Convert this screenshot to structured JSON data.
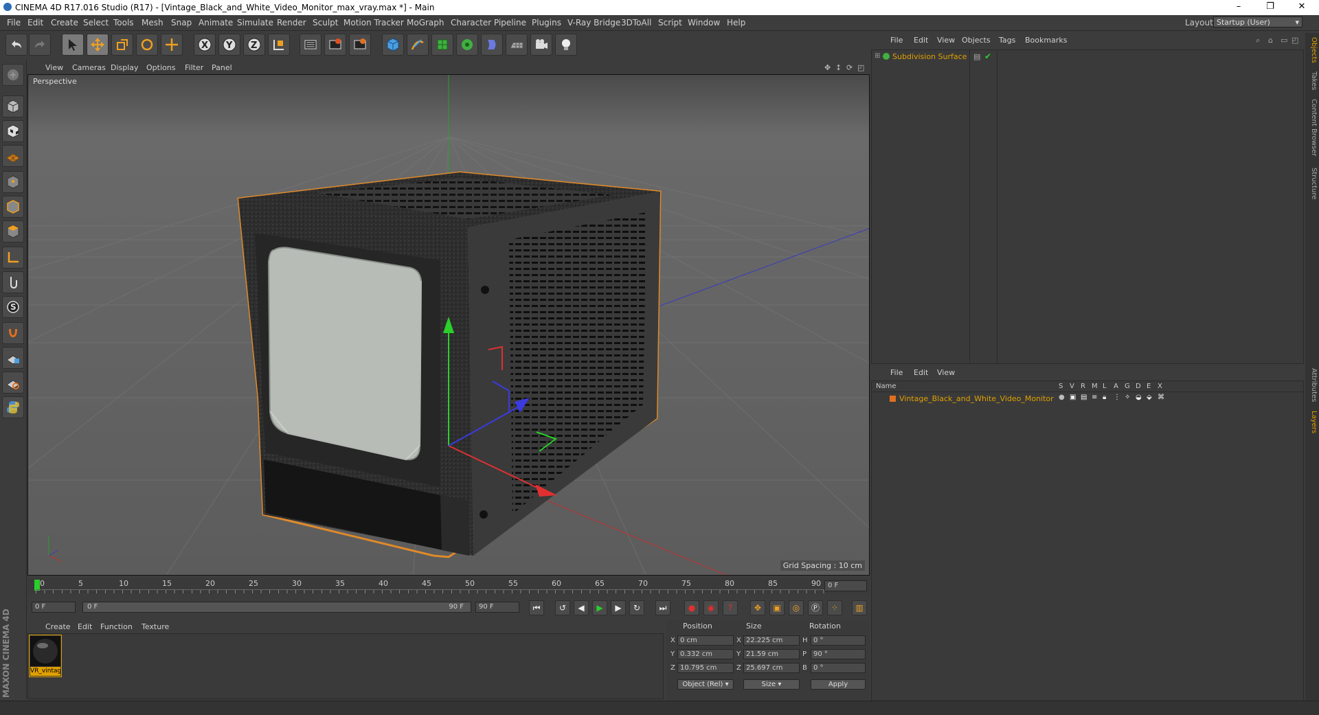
{
  "window": {
    "title": "CINEMA 4D R17.016 Studio (R17) - [Vintage_Black_and_White_Video_Monitor_max_vray.max *] - Main",
    "controls": [
      "–",
      "❐",
      "✕"
    ]
  },
  "menubar": {
    "items": [
      "File",
      "Edit",
      "Create",
      "Select",
      "Tools",
      "Mesh",
      "Snap",
      "Animate",
      "Simulate",
      "Render",
      "Sculpt",
      "Motion Tracker",
      "MoGraph",
      "Character",
      "Pipeline",
      "Plugins",
      "V-Ray Bridge",
      "3DToAll",
      "Script",
      "Window",
      "Help"
    ],
    "layout_label": "Layout:",
    "layout_value": "Startup (User)"
  },
  "toolbar": {
    "icons": [
      "undo-icon",
      "redo-icon",
      "select-arrow-icon",
      "move-icon",
      "scale-icon",
      "rotate-icon",
      "live-select-icon",
      "x-axis-icon",
      "y-axis-icon",
      "z-axis-icon",
      "coordinate-system-icon",
      "render-view-icon",
      "render-picture-viewer-icon",
      "render-settings-icon",
      "cube-icon",
      "pen-spline-icon",
      "subdivision-icon",
      "cloner-icon",
      "deformer-icon",
      "floor-icon",
      "camera-icon",
      "light-icon"
    ]
  },
  "lefttools": {
    "icons": [
      "make-editable-icon",
      "model-mode-icon",
      "texture-mode-icon",
      "workplane-icon",
      "points-mode-icon",
      "edges-mode-icon",
      "polygons-mode-icon",
      "axis-mode-icon",
      "tweak-icon",
      "solo-icon",
      "snap-icon",
      "locked-workplane-icon",
      "grid-snap-icon",
      "python-icon"
    ]
  },
  "viewport": {
    "menu": [
      "View",
      "Cameras",
      "Display",
      "Options",
      "Filter",
      "Panel"
    ],
    "label": "Perspective",
    "grid_spacing": "Grid Spacing : 10 cm",
    "colors": {
      "bg_top": "#4a4a4a",
      "bg_bottom": "#6a6a6a",
      "selection": "#e08a2a"
    }
  },
  "timeline": {
    "ticks": [
      "0",
      "5",
      "10",
      "15",
      "20",
      "25",
      "30",
      "35",
      "40",
      "45",
      "50",
      "55",
      "60",
      "65",
      "70",
      "75",
      "80",
      "85",
      "90"
    ],
    "current_frame_field": "0 F"
  },
  "playbar": {
    "start_field": "0 F",
    "range_left": "0 F",
    "range_right": "90 F",
    "end_field": "90 F"
  },
  "material_manager": {
    "menu": [
      "Create",
      "Edit",
      "Function",
      "Texture"
    ],
    "material_name": "VR_vintage",
    "maxon_logo": "MAXON CINEMA 4D"
  },
  "coordinates": {
    "headers": [
      "Position",
      "Size",
      "Rotation"
    ],
    "rows": [
      {
        "axis": "X",
        "pos": "0 cm",
        "size_axis": "X",
        "size": "22.225 cm",
        "rot_axis": "H",
        "rot": "0 °"
      },
      {
        "axis": "Y",
        "pos": "0.332 cm",
        "size_axis": "Y",
        "size": "21.59 cm",
        "rot_axis": "P",
        "rot": "90 °"
      },
      {
        "axis": "Z",
        "pos": "10.795 cm",
        "size_axis": "Z",
        "size": "25.697 cm",
        "rot_axis": "B",
        "rot": "0 °"
      }
    ],
    "mode_dropdown": "Object (Rel)",
    "size_dropdown": "Size",
    "apply_label": "Apply"
  },
  "object_manager": {
    "menu": [
      "File",
      "Edit",
      "View",
      "Objects",
      "Tags",
      "Bookmarks"
    ],
    "objects": [
      {
        "name": "Subdivision Surface",
        "color": "#e0a000"
      }
    ]
  },
  "layer_manager": {
    "menu": [
      "File",
      "Edit",
      "View"
    ],
    "columns": [
      "Name",
      "S",
      "V",
      "R",
      "M",
      "L",
      "A",
      "G",
      "D",
      "E",
      "X"
    ],
    "layers": [
      {
        "name": "Vintage_Black_and_White_Video_Monitor",
        "color": "#e07020"
      }
    ]
  },
  "side_tabs": [
    "Objects",
    "Takes",
    "Content Browser",
    "Structure",
    "Attributes",
    "Layers"
  ]
}
